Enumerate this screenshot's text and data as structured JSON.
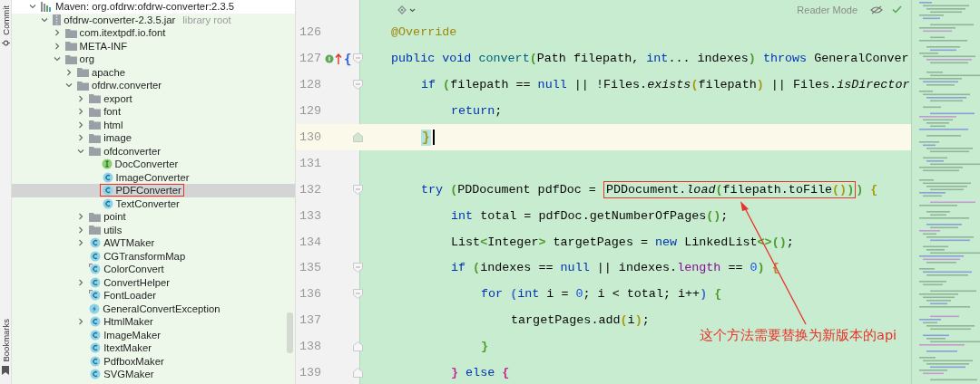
{
  "tool_strip": [
    {
      "label": "Commit",
      "kind": "commit"
    },
    {
      "label": "Bookmarks",
      "kind": "bookmarks"
    }
  ],
  "project_tree": [
    {
      "label": "Maven: org.ofdrw:ofdrw-converter:2.3.5",
      "kind": "library",
      "expanded": true,
      "selected": false,
      "boxed": false,
      "tinted": false,
      "children": [
        {
          "label": "ofdrw-converter-2.3.5.jar",
          "note": "library root",
          "kind": "jar",
          "expanded": true,
          "selected": false,
          "boxed": false,
          "tinted": true,
          "children": [
            {
              "label": "com.itextpdf.io.font",
              "kind": "package",
              "expanded": false,
              "selected": false,
              "boxed": false,
              "tinted": true
            },
            {
              "label": "META-INF",
              "kind": "package",
              "expanded": false,
              "selected": false,
              "boxed": false,
              "tinted": true
            },
            {
              "label": "org",
              "kind": "package",
              "expanded": true,
              "selected": false,
              "boxed": false,
              "tinted": true,
              "children": [
                {
                  "label": "apache",
                  "kind": "package",
                  "expanded": false,
                  "selected": false,
                  "boxed": false,
                  "tinted": true
                },
                {
                  "label": "ofdrw.converter",
                  "kind": "package",
                  "expanded": true,
                  "selected": false,
                  "boxed": false,
                  "tinted": true,
                  "children": [
                    {
                      "label": "export",
                      "kind": "package",
                      "expanded": false,
                      "selected": false,
                      "boxed": false,
                      "tinted": true
                    },
                    {
                      "label": "font",
                      "kind": "package",
                      "expanded": false,
                      "selected": false,
                      "boxed": false,
                      "tinted": true
                    },
                    {
                      "label": "html",
                      "kind": "package",
                      "expanded": false,
                      "selected": false,
                      "boxed": false,
                      "tinted": true
                    },
                    {
                      "label": "image",
                      "kind": "package",
                      "expanded": false,
                      "selected": false,
                      "boxed": false,
                      "tinted": true
                    },
                    {
                      "label": "ofdconverter",
                      "kind": "package",
                      "expanded": true,
                      "selected": false,
                      "boxed": false,
                      "tinted": true,
                      "children": [
                        {
                          "label": "DocConverter",
                          "kind": "interface",
                          "selected": false,
                          "boxed": false,
                          "tinted": true
                        },
                        {
                          "label": "ImageConverter",
                          "kind": "class",
                          "selected": false,
                          "boxed": false,
                          "tinted": true
                        },
                        {
                          "label": "PDFConverter",
                          "kind": "class",
                          "selected": true,
                          "boxed": true,
                          "tinted": true
                        },
                        {
                          "label": "TextConverter",
                          "kind": "class",
                          "selected": false,
                          "boxed": false,
                          "tinted": true
                        }
                      ]
                    },
                    {
                      "label": "point",
                      "kind": "package",
                      "expanded": false,
                      "selected": false,
                      "boxed": false,
                      "tinted": true
                    },
                    {
                      "label": "utils",
                      "kind": "package",
                      "expanded": false,
                      "selected": false,
                      "boxed": false,
                      "tinted": true
                    },
                    {
                      "label": "AWTMaker",
                      "kind": "class",
                      "expanded": false,
                      "selected": false,
                      "boxed": false,
                      "tinted": true
                    },
                    {
                      "label": "CGTransformMap",
                      "kind": "class",
                      "selected": false,
                      "boxed": false,
                      "tinted": true
                    },
                    {
                      "label": "ColorConvert",
                      "kind": "class_alt",
                      "selected": false,
                      "boxed": false,
                      "tinted": true
                    },
                    {
                      "label": "ConvertHelper",
                      "kind": "class",
                      "expanded": false,
                      "selected": false,
                      "boxed": false,
                      "tinted": true
                    },
                    {
                      "label": "FontLoader",
                      "kind": "class_alt",
                      "selected": false,
                      "boxed": false,
                      "tinted": true
                    },
                    {
                      "label": "GeneralConvertException",
                      "kind": "exception",
                      "selected": false,
                      "boxed": false,
                      "tinted": true
                    },
                    {
                      "label": "HtmlMaker",
                      "kind": "class",
                      "expanded": false,
                      "selected": false,
                      "boxed": false,
                      "tinted": true
                    },
                    {
                      "label": "ImageMaker",
                      "kind": "class",
                      "selected": false,
                      "boxed": false,
                      "tinted": true
                    },
                    {
                      "label": "ItextMaker",
                      "kind": "class",
                      "selected": false,
                      "boxed": false,
                      "tinted": true
                    },
                    {
                      "label": "PdfboxMaker",
                      "kind": "class",
                      "selected": false,
                      "boxed": false,
                      "tinted": true
                    },
                    {
                      "label": "SVGMaker",
                      "kind": "class",
                      "selected": false,
                      "boxed": false,
                      "tinted": true
                    }
                  ]
                }
              ]
            }
          ]
        }
      ]
    }
  ],
  "editor": {
    "reader_mode": "Reader Mode",
    "lines": [
      {
        "number": "126",
        "current": false,
        "caret": false,
        "tokens": [
          {
            "t": "@Override",
            "kind": "annotation"
          }
        ]
      },
      {
        "number": "127",
        "current": false,
        "caret": false,
        "gutter_marks": [
          {
            "kind": "implements"
          },
          {
            "kind": "override"
          }
        ],
        "gutter_text": "{",
        "fold": {
          "kind": "start"
        },
        "tokens": [
          {
            "t": "public void ",
            "kind": "keyword"
          },
          {
            "t": "convert",
            "kind": "method"
          },
          {
            "t": "(",
            "kind": "brace",
            "color": "#4d9b2a"
          },
          {
            "t": "Path filepath, ",
            "kind": "plain"
          },
          {
            "t": "int",
            "kind": "keyword"
          },
          {
            "t": "... indexes",
            "kind": "plain"
          },
          {
            "t": ")",
            "kind": "brace",
            "color": "#4d9b2a"
          },
          {
            "t": " throws",
            "kind": "keyword"
          },
          {
            "t": " GeneralConver",
            "kind": "plain"
          }
        ],
        "children": [
          {
            "number": "128",
            "current": false,
            "caret": false,
            "fold": {
              "kind": "start"
            },
            "tokens": [
              {
                "t": "if ",
                "kind": "keyword"
              },
              {
                "t": "(",
                "kind": "brace",
                "color": "#4d9b2a"
              },
              {
                "t": "filepath == ",
                "kind": "plain"
              },
              {
                "t": "null",
                "kind": "keyword"
              },
              {
                "t": " || !Files.",
                "kind": "plain"
              },
              {
                "t": "exists",
                "kind": "static"
              },
              {
                "t": "(",
                "kind": "brace",
                "color": "#a89a10"
              },
              {
                "t": "filepath",
                "kind": "plain"
              },
              {
                "t": ")",
                "kind": "brace",
                "color": "#a89a10"
              },
              {
                "t": " || Files.",
                "kind": "plain"
              },
              {
                "t": "isDirector",
                "kind": "static"
              }
            ],
            "children": [
              {
                "number": "129",
                "current": false,
                "caret": false,
                "tokens": [
                  {
                    "t": "return",
                    "kind": "keyword"
                  },
                  {
                    "t": ";",
                    "kind": "plain"
                  }
                ]
              }
            ]
          },
          {
            "number": "130",
            "current": true,
            "caret": true,
            "fold": {
              "kind": "end"
            },
            "tokens": [
              {
                "t": "}",
                "kind": "brace",
                "color": "#a89a10",
                "match": true
              }
            ]
          },
          {
            "number": "131",
            "current": false,
            "caret": false
          },
          {
            "number": "132",
            "current": false,
            "caret": false,
            "fold": {
              "kind": "start"
            },
            "tokens": [
              {
                "t": "try ",
                "kind": "keyword"
              },
              {
                "t": "(",
                "kind": "brace",
                "color": "#4d9b2a"
              },
              {
                "t": "PDDocument pdfDoc = ",
                "kind": "plain"
              },
              {
                "t": "PDDocument.",
                "kind": "plain",
                "boxed": true
              },
              {
                "t": "load",
                "kind": "static",
                "boxed": true
              },
              {
                "t": "(",
                "kind": "brace",
                "color": "#4d9b2a",
                "boxed": true
              },
              {
                "t": "filepath.toFile",
                "kind": "plain",
                "boxed": true
              },
              {
                "t": "()",
                "kind": "brace",
                "color": "#a89a10",
                "boxed": true
              },
              {
                "t": ")",
                "kind": "brace",
                "color": "#4d9b2a",
                "boxed": true
              },
              {
                "t": ")",
                "kind": "brace",
                "color": "#4d9b2a"
              },
              {
                "t": " {",
                "kind": "brace",
                "color": "#a89a10"
              }
            ],
            "children": [
              {
                "number": "133",
                "current": false,
                "caret": false,
                "tokens": [
                  {
                    "t": "int",
                    "kind": "keyword"
                  },
                  {
                    "t": " total = pdfDoc.getNumberOfPages",
                    "kind": "plain"
                  },
                  {
                    "t": "()",
                    "kind": "brace",
                    "color": "#4d9b2a"
                  },
                  {
                    "t": ";",
                    "kind": "plain"
                  }
                ]
              },
              {
                "number": "134",
                "current": false,
                "caret": false,
                "tokens": [
                  {
                    "t": "List",
                    "kind": "plain"
                  },
                  {
                    "t": "<",
                    "kind": "brace",
                    "color": "#4d9b2a"
                  },
                  {
                    "t": "Integer",
                    "kind": "plain"
                  },
                  {
                    "t": ">",
                    "kind": "brace",
                    "color": "#4d9b2a"
                  },
                  {
                    "t": " targetPages = ",
                    "kind": "plain"
                  },
                  {
                    "t": "new",
                    "kind": "keyword"
                  },
                  {
                    "t": " LinkedList",
                    "kind": "plain"
                  },
                  {
                    "t": "<>",
                    "kind": "brace",
                    "color": "#4d9b2a"
                  },
                  {
                    "t": "()",
                    "kind": "brace",
                    "color": "#4d9b2a"
                  },
                  {
                    "t": ";",
                    "kind": "plain"
                  }
                ]
              },
              {
                "number": "135",
                "current": false,
                "caret": false,
                "fold": {
                  "kind": "start"
                },
                "tokens": [
                  {
                    "t": "if ",
                    "kind": "keyword"
                  },
                  {
                    "t": "(",
                    "kind": "brace",
                    "color": "#4d9b2a"
                  },
                  {
                    "t": "indexes == ",
                    "kind": "plain"
                  },
                  {
                    "t": "null",
                    "kind": "keyword"
                  },
                  {
                    "t": " || indexes.",
                    "kind": "plain"
                  },
                  {
                    "t": "length",
                    "kind": "field"
                  },
                  {
                    "t": " == ",
                    "kind": "plain"
                  },
                  {
                    "t": "0",
                    "kind": "number"
                  },
                  {
                    "t": ")",
                    "kind": "brace",
                    "color": "#4d9b2a"
                  },
                  {
                    "t": " {",
                    "kind": "brace",
                    "color": "#c0782a"
                  }
                ],
                "children": [
                  {
                    "number": "136",
                    "current": false,
                    "caret": false,
                    "fold": {
                      "kind": "start"
                    },
                    "tokens": [
                      {
                        "t": "for ",
                        "kind": "keyword"
                      },
                      {
                        "t": "(",
                        "kind": "brace",
                        "color": "#3c6fd0"
                      },
                      {
                        "t": "int",
                        "kind": "keyword"
                      },
                      {
                        "t": " i = ",
                        "kind": "plain"
                      },
                      {
                        "t": "0",
                        "kind": "number"
                      },
                      {
                        "t": "; i < total; i++",
                        "kind": "plain"
                      },
                      {
                        "t": ")",
                        "kind": "brace",
                        "color": "#3c6fd0"
                      },
                      {
                        "t": " {",
                        "kind": "brace",
                        "color": "#4d9b2a"
                      }
                    ],
                    "children": [
                      {
                        "number": "137",
                        "current": false,
                        "caret": false,
                        "tokens": [
                          {
                            "t": "targetPages.add",
                            "kind": "plain"
                          },
                          {
                            "t": "(",
                            "kind": "brace",
                            "color": "#a89a10"
                          },
                          {
                            "t": "i",
                            "kind": "plain"
                          },
                          {
                            "t": ")",
                            "kind": "brace",
                            "color": "#a89a10"
                          },
                          {
                            "t": ";",
                            "kind": "plain"
                          }
                        ]
                      }
                    ]
                  },
                  {
                    "number": "138",
                    "current": false,
                    "caret": false,
                    "fold": {
                      "kind": "end"
                    },
                    "tokens": [
                      {
                        "t": "}",
                        "kind": "brace",
                        "color": "#4d9b2a"
                      }
                    ]
                  }
                ]
              },
              {
                "number": "139",
                "current": false,
                "caret": false,
                "fold": {
                  "kind": "end"
                },
                "tokens": [
                  {
                    "t": "}",
                    "kind": "brace",
                    "color": "#c2288b"
                  },
                  {
                    "t": " else",
                    "kind": "keyword"
                  },
                  {
                    "t": " {",
                    "kind": "brace",
                    "color": "#c2288b"
                  }
                ]
              }
            ]
          }
        ]
      }
    ],
    "annotation": {
      "text": "这个方法需要替换为新版本的api"
    }
  }
}
